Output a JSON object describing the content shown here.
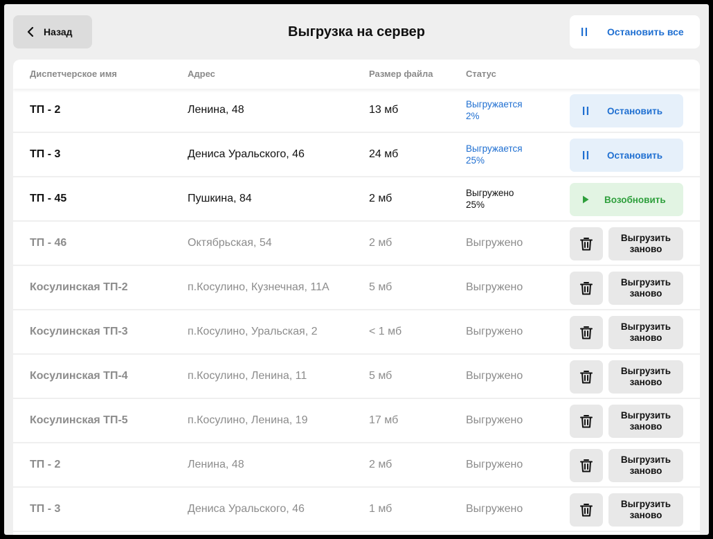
{
  "header": {
    "back_label": "Назад",
    "title": "Выгрузка на сервер",
    "stop_all_label": "Остановить все"
  },
  "table": {
    "columns": [
      "Диспетчерское имя",
      "Адрес",
      "Размер файла",
      "Статус"
    ],
    "rows": [
      {
        "name": "ТП - 2",
        "address": "Ленина, 48",
        "size": "13 мб",
        "status": "Выгружается",
        "percent": "2%",
        "action": "Остановить"
      },
      {
        "name": "ТП - 3",
        "address": "Дениса Уральского, 46",
        "size": "24 мб",
        "status": "Выгружается",
        "percent": "25%",
        "action": "Остановить"
      },
      {
        "name": "ТП - 45",
        "address": "Пушкина, 84",
        "size": "2 мб",
        "status": "Выгружено",
        "percent": "25%",
        "action": "Возобновить"
      },
      {
        "name": "ТП - 46",
        "address": "Октябрьская, 54",
        "size": "2 мб",
        "status": "Выгружено",
        "action": "Выгрузить заново"
      },
      {
        "name": "Косулинская ТП-2",
        "address": "п.Косулино, Кузнечная, 11А",
        "size": "5 мб",
        "status": "Выгружено",
        "action": "Выгрузить заново"
      },
      {
        "name": "Косулинская ТП-3",
        "address": "п.Косулино, Уральская, 2",
        "size": "< 1 мб",
        "status": "Выгружено",
        "action": "Выгрузить заново"
      },
      {
        "name": "Косулинская ТП-4",
        "address": "п.Косулино, Ленина, 11",
        "size": "5 мб",
        "status": "Выгружено",
        "action": "Выгрузить заново"
      },
      {
        "name": "Косулинская ТП-5",
        "address": "п.Косулино, Ленина, 19",
        "size": "17 мб",
        "status": "Выгружено",
        "action": "Выгрузить заново"
      },
      {
        "name": "ТП - 2",
        "address": "Ленина, 48",
        "size": "2 мб",
        "status": "Выгружено",
        "action": "Выгрузить заново"
      },
      {
        "name": "ТП - 3",
        "address": "Дениса Уральского, 46",
        "size": "1 мб",
        "status": "Выгружено",
        "action": "Выгрузить заново"
      }
    ]
  },
  "icons": {
    "back": "chevron-left-icon",
    "pause": "pause-icon",
    "play": "play-icon",
    "delete": "trash-icon"
  },
  "colors": {
    "accent_blue": "#1f6fd1",
    "accent_green": "#2e9f3c",
    "stop_bg": "#e6f0fa",
    "resume_bg": "#e2f4e3",
    "page_bg": "#efefef"
  }
}
